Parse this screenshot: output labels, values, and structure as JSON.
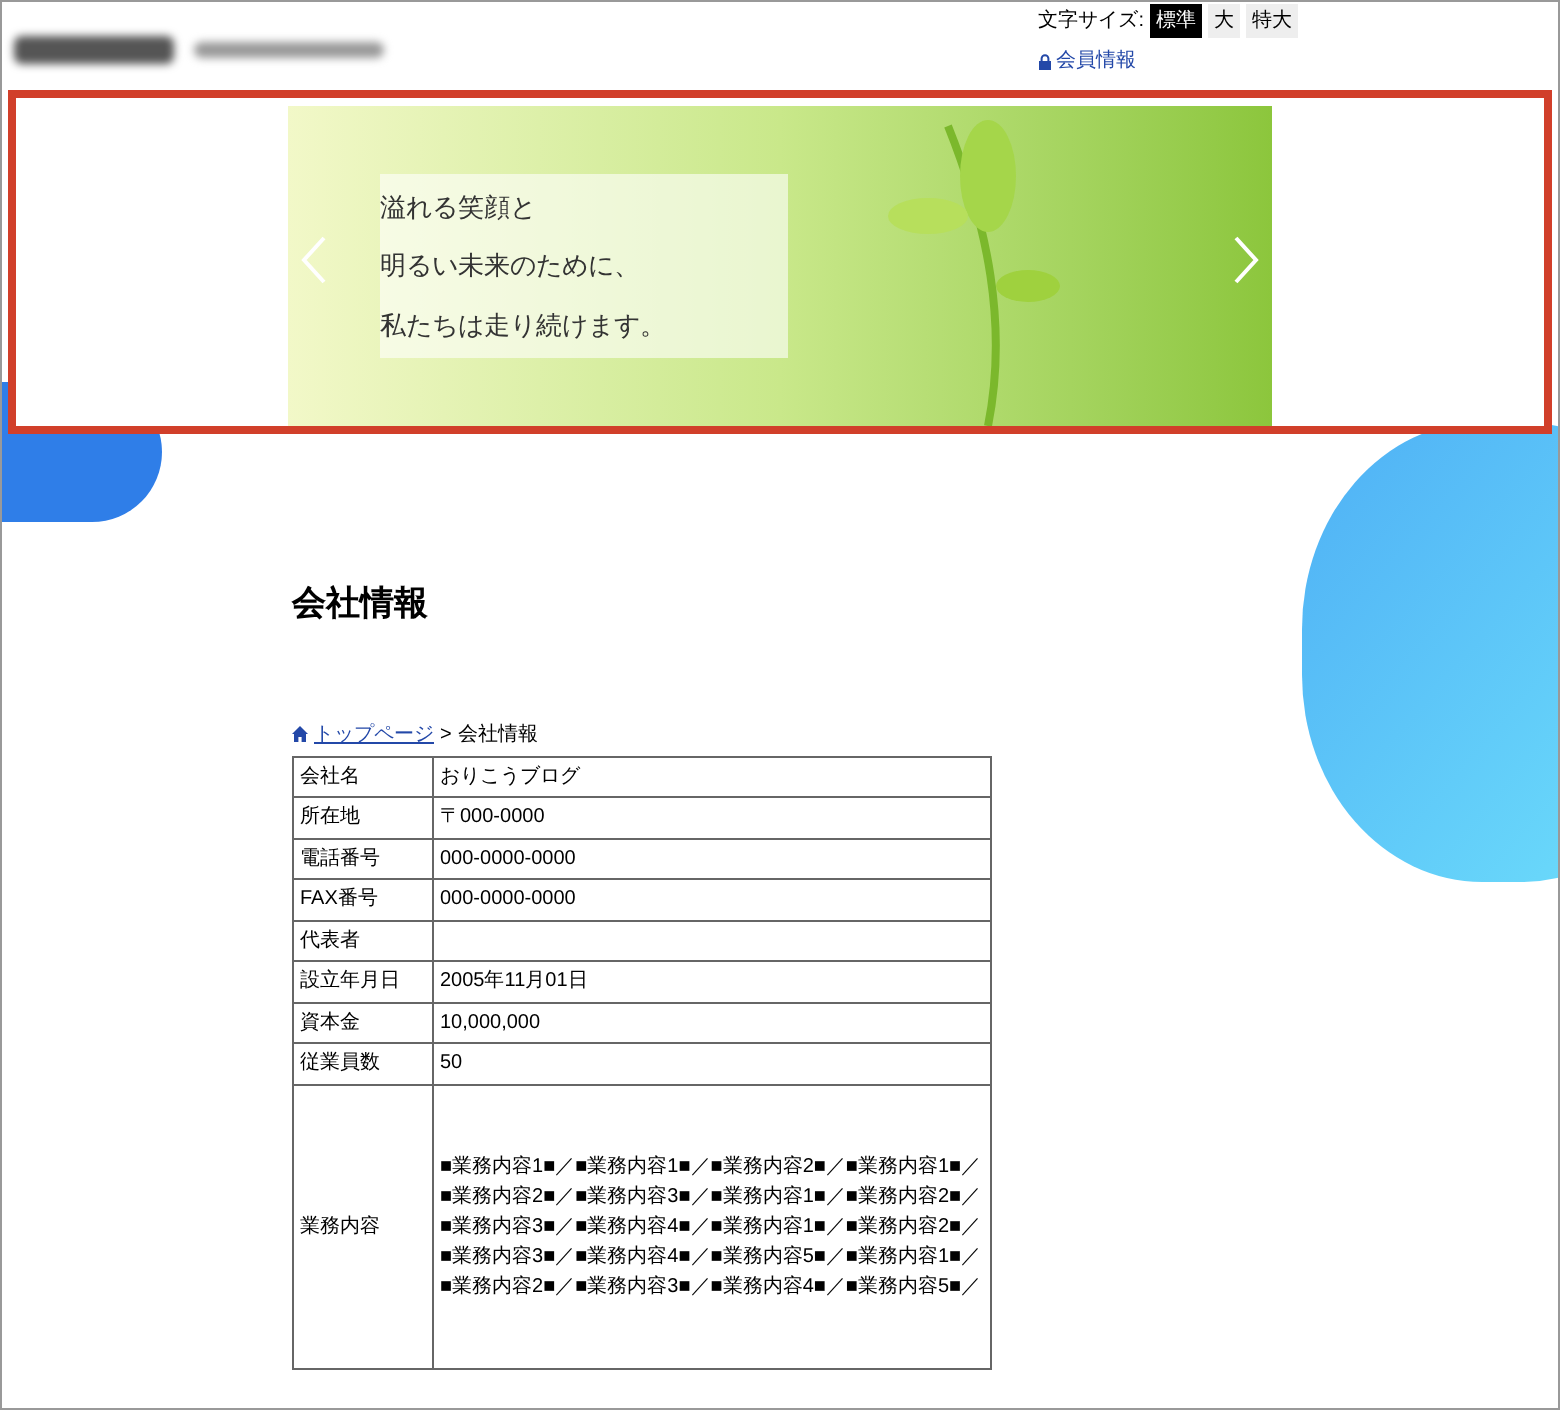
{
  "header": {
    "font_size_label": "文字サイズ:",
    "font_sizes": [
      {
        "label": "標準",
        "selected": true
      },
      {
        "label": "大",
        "selected": false
      },
      {
        "label": "特大",
        "selected": false
      }
    ],
    "member_link": "会員情報"
  },
  "slider": {
    "caption": [
      "溢れる笑顔と",
      "明るい未来のために、",
      "私たちは走り続けます。"
    ]
  },
  "page_title": "会社情報",
  "breadcrumb": {
    "home": "トップページ",
    "separator": ">",
    "current": "会社情報"
  },
  "table": {
    "rows": [
      {
        "label": "会社名",
        "value": "おりこうブログ"
      },
      {
        "label": "所在地",
        "value": "〒000-0000"
      },
      {
        "label": "電話番号",
        "value": "000-0000-0000"
      },
      {
        "label": "FAX番号",
        "value": "000-0000-0000"
      },
      {
        "label": "代表者",
        "value": ""
      },
      {
        "label": "設立年月日",
        "value": "2005年11月01日"
      },
      {
        "label": "資本金",
        "value": "10,000,000"
      },
      {
        "label": "従業員数",
        "value": "50"
      },
      {
        "label": "業務内容",
        "value": "■業務内容1■／■業務内容1■／■業務内容2■／■業務内容1■／■業務内容2■／■業務内容3■／■業務内容1■／■業務内容2■／■業務内容3■／■業務内容4■／■業務内容1■／■業務内容2■／■業務内容3■／■業務内容4■／■業務内容5■／■業務内容1■／■業務内容2■／■業務内容3■／■業務内容4■／■業務内容5■／",
        "tall": true
      }
    ]
  }
}
